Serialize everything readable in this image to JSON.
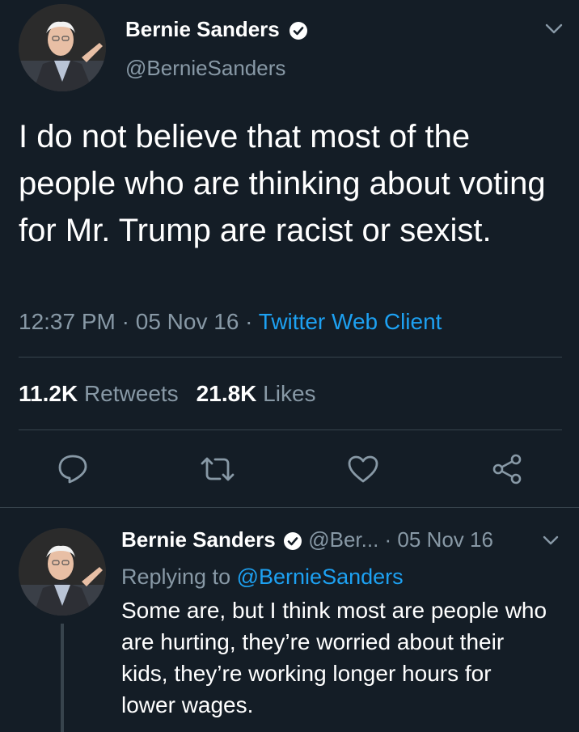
{
  "main_tweet": {
    "author_name": "Bernie Sanders",
    "author_handle": "@BernieSanders",
    "text": "I do not believe that most of the people who are thinking about voting for Mr. Trump are racist or sexist.",
    "time": "12:37 PM",
    "date": "05 Nov 16",
    "client": "Twitter Web Client",
    "retweets_count": "11.2K",
    "retweets_label": "Retweets",
    "likes_count": "21.8K",
    "likes_label": "Likes"
  },
  "actions": {
    "reply_icon": "reply-icon",
    "retweet_icon": "retweet-icon",
    "like_icon": "heart-icon",
    "share_icon": "share-icon"
  },
  "reply_tweet": {
    "author_name": "Bernie Sanders",
    "author_handle": "@Ber...",
    "date": "05 Nov 16",
    "replying_prefix": "Replying to",
    "replying_handle": "@BernieSanders",
    "text": "Some are, but I think most are people who are hurting, they’re worried about their kids, they’re working longer hours for lower wages."
  },
  "colors": {
    "background": "#141d26",
    "accent": "#1da1f2",
    "muted": "#8899a6",
    "divider": "#38444d"
  }
}
